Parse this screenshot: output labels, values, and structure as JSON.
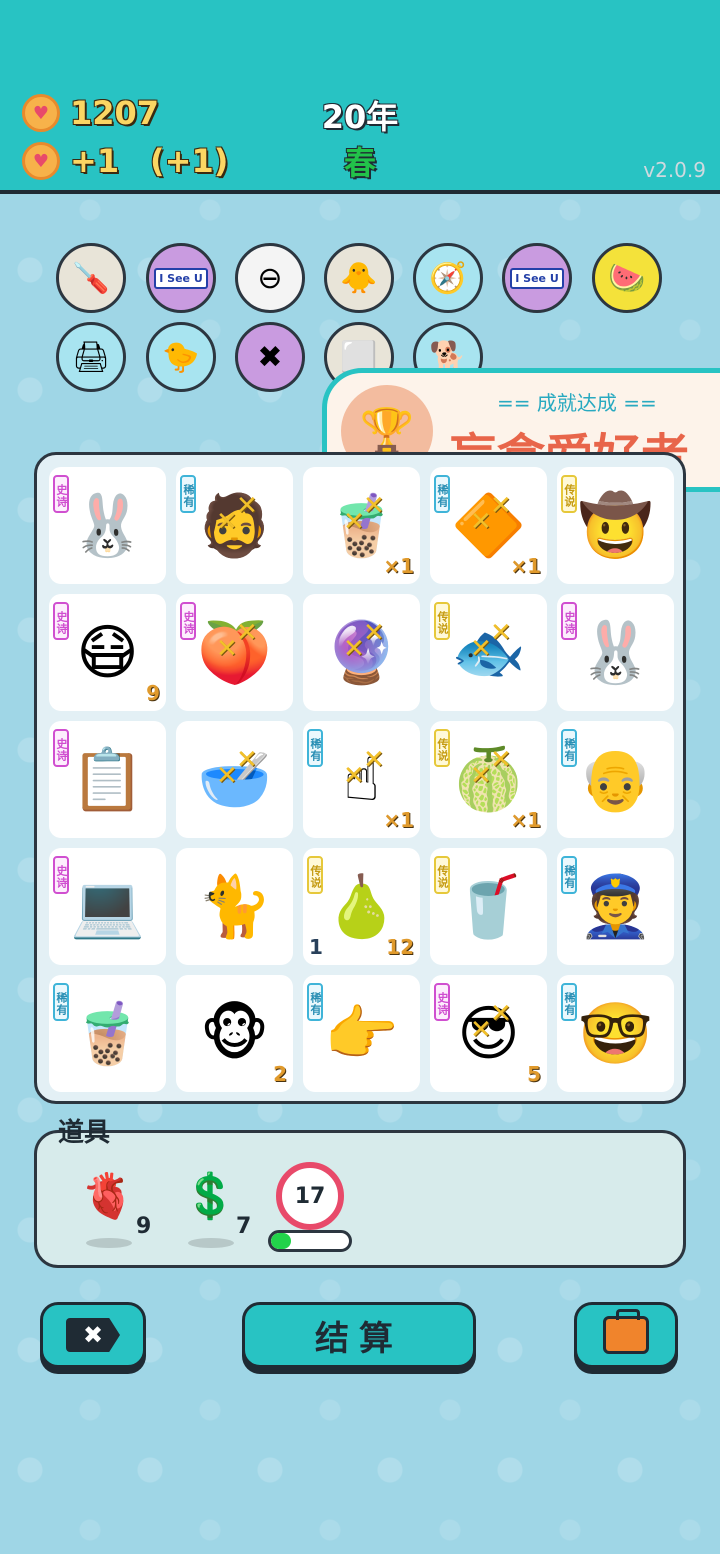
{
  "header": {
    "coins": "1207",
    "income": "+1",
    "income_bonus": "(+1)",
    "year": "20年",
    "season": "春",
    "version": "v2.0.9"
  },
  "relics": [
    {
      "name": "screwdriver-icon",
      "glyph": "🪛",
      "bg": "#e8e4d8"
    },
    {
      "name": "i-see-u-icon",
      "text": "I See U",
      "bg": "#c99be0"
    },
    {
      "name": "minus-circle-icon",
      "glyph": "⊖",
      "bg": "#f4f4f4"
    },
    {
      "name": "chick-egg-icon",
      "glyph": "🐥",
      "bg": "#e8e4d8"
    },
    {
      "name": "compass-icon",
      "glyph": "🧭",
      "bg": "#a8e4f0"
    },
    {
      "name": "i-see-u-icon",
      "text": "I See U",
      "bg": "#c99be0"
    },
    {
      "name": "fruit-basket-icon",
      "glyph": "🍉",
      "bg": "#f4e23a"
    },
    {
      "name": "printer-icon",
      "glyph": "🖨",
      "bg": "#a8e4f0"
    },
    {
      "name": "chick-egg-icon",
      "glyph": "🐤",
      "bg": "#a8e4f0"
    },
    {
      "name": "multiplier-icon",
      "glyph": "✖",
      "bg": "#c99be0"
    },
    {
      "name": "tiles-icon",
      "glyph": "⬜",
      "bg": "#e8e4d8"
    },
    {
      "name": "dog-icon",
      "glyph": "🐕",
      "bg": "#a8e4f0"
    }
  ],
  "achievement": {
    "subtitle": "== 成就达成 ==",
    "title": "盲盒爱好者"
  },
  "tags": {
    "epic": "史诗",
    "rare": "稀有",
    "legend": "传说"
  },
  "grid": [
    {
      "name": "rabbit-box-icon",
      "glyph": "🐰",
      "tag": "epic"
    },
    {
      "name": "rapper-face-icon",
      "glyph": "🧔",
      "tag": "rare",
      "x": true
    },
    {
      "name": "milk-tea-icon",
      "glyph": "🧋",
      "x": true,
      "count": "×1"
    },
    {
      "name": "gold-badge-icon",
      "glyph": "🔶",
      "tag": "rare",
      "x": true,
      "count": "×1"
    },
    {
      "name": "cowboy-face-icon",
      "glyph": "🤠",
      "tag": "legend"
    },
    {
      "name": "green-hat-face-icon",
      "glyph": "😷",
      "tag": "epic",
      "count": "9"
    },
    {
      "name": "peach-icon",
      "glyph": "🍑",
      "tag": "epic",
      "x": true
    },
    {
      "name": "multiplier-ball-icon",
      "glyph": "🔮",
      "x": true
    },
    {
      "name": "koi-fish-icon",
      "glyph": "🐟",
      "tag": "legend",
      "x": true
    },
    {
      "name": "rabbit-box-icon",
      "glyph": "🐰",
      "tag": "epic"
    },
    {
      "name": "copy-paste-icon",
      "glyph": "📋",
      "tag": "epic"
    },
    {
      "name": "soup-bowl-icon",
      "glyph": "🥣",
      "x": true
    },
    {
      "name": "pointing-hand-icon",
      "glyph": "☝",
      "tag": "rare",
      "x": true,
      "count": "×1"
    },
    {
      "name": "melon-icon",
      "glyph": "🍈",
      "tag": "legend",
      "x": true,
      "count": "×1"
    },
    {
      "name": "bald-face-icon",
      "glyph": "👴",
      "tag": "rare"
    },
    {
      "name": "gpu-card-icon",
      "glyph": "💻",
      "tag": "epic"
    },
    {
      "name": "cat-icon",
      "glyph": "🐈"
    },
    {
      "name": "longan-icon",
      "glyph": "🍐",
      "tag": "legend",
      "count": "12",
      "count_left": "1"
    },
    {
      "name": "bubble-tea-icon",
      "glyph": "🥤",
      "tag": "legend"
    },
    {
      "name": "police-face-icon",
      "glyph": "👮",
      "tag": "rare"
    },
    {
      "name": "tea-cup-icon",
      "glyph": "🧋",
      "tag": "rare"
    },
    {
      "name": "monkey-face-icon",
      "glyph": "🐵",
      "count": "2"
    },
    {
      "name": "pointing-right-icon",
      "glyph": "👉",
      "tag": "rare"
    },
    {
      "name": "green-hat-face-icon",
      "glyph": "😎",
      "tag": "epic",
      "x": true,
      "count": "5"
    },
    {
      "name": "glasses-face-icon",
      "glyph": "🤓",
      "tag": "rare"
    }
  ],
  "items_panel": {
    "title": "道具",
    "items": [
      {
        "name": "liver-icon",
        "glyph": "🫀",
        "count": "9"
      },
      {
        "name": "dollar-coin-icon",
        "glyph": "💲",
        "count": "7"
      }
    ],
    "timer": "17",
    "timer_progress": 0.25
  },
  "buttons": {
    "settle": "结算",
    "exit_symbol": "✖"
  }
}
